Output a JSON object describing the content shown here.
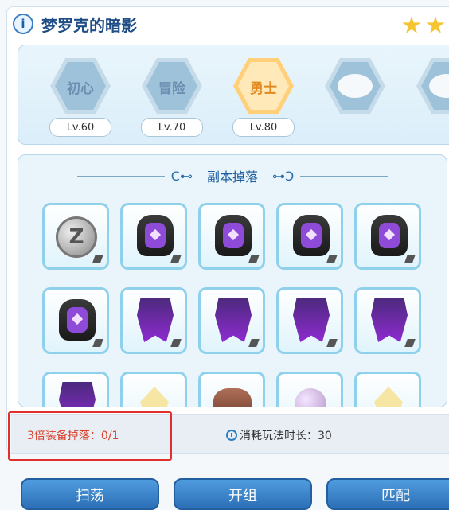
{
  "header": {
    "info_icon": "i",
    "title": "梦罗克的暗影",
    "stars_icon": "star-icon"
  },
  "levels": [
    {
      "label": "初心",
      "lv": "Lv.60"
    },
    {
      "label": "冒险",
      "lv": "Lv.70"
    },
    {
      "label": "勇士",
      "lv": "Lv.80"
    },
    {
      "label": "",
      "lv": ""
    },
    {
      "label": "",
      "lv": ""
    }
  ],
  "drops": {
    "title": "副本掉落",
    "deco_left": "C⊷",
    "deco_right": "⊶Ↄ",
    "items": [
      {
        "name": "zeny-coin-icon",
        "glyph": "Z"
      },
      {
        "name": "armor-icon"
      },
      {
        "name": "armor-icon"
      },
      {
        "name": "armor-icon"
      },
      {
        "name": "armor-icon"
      },
      {
        "name": "armor-icon"
      },
      {
        "name": "cape-icon"
      },
      {
        "name": "cape-icon"
      },
      {
        "name": "cape-icon"
      },
      {
        "name": "cape-icon"
      },
      {
        "name": "cape-icon"
      },
      {
        "name": "crystal-icon"
      },
      {
        "name": "shell-icon"
      },
      {
        "name": "pearl-icon"
      },
      {
        "name": "crystal-icon"
      }
    ]
  },
  "info": {
    "triple_drop": "3倍装备掉落：0/1",
    "time_cost": "消耗玩法时长：30"
  },
  "buttons": {
    "sweep": "扫荡",
    "team": "开组",
    "match": "匹配"
  }
}
